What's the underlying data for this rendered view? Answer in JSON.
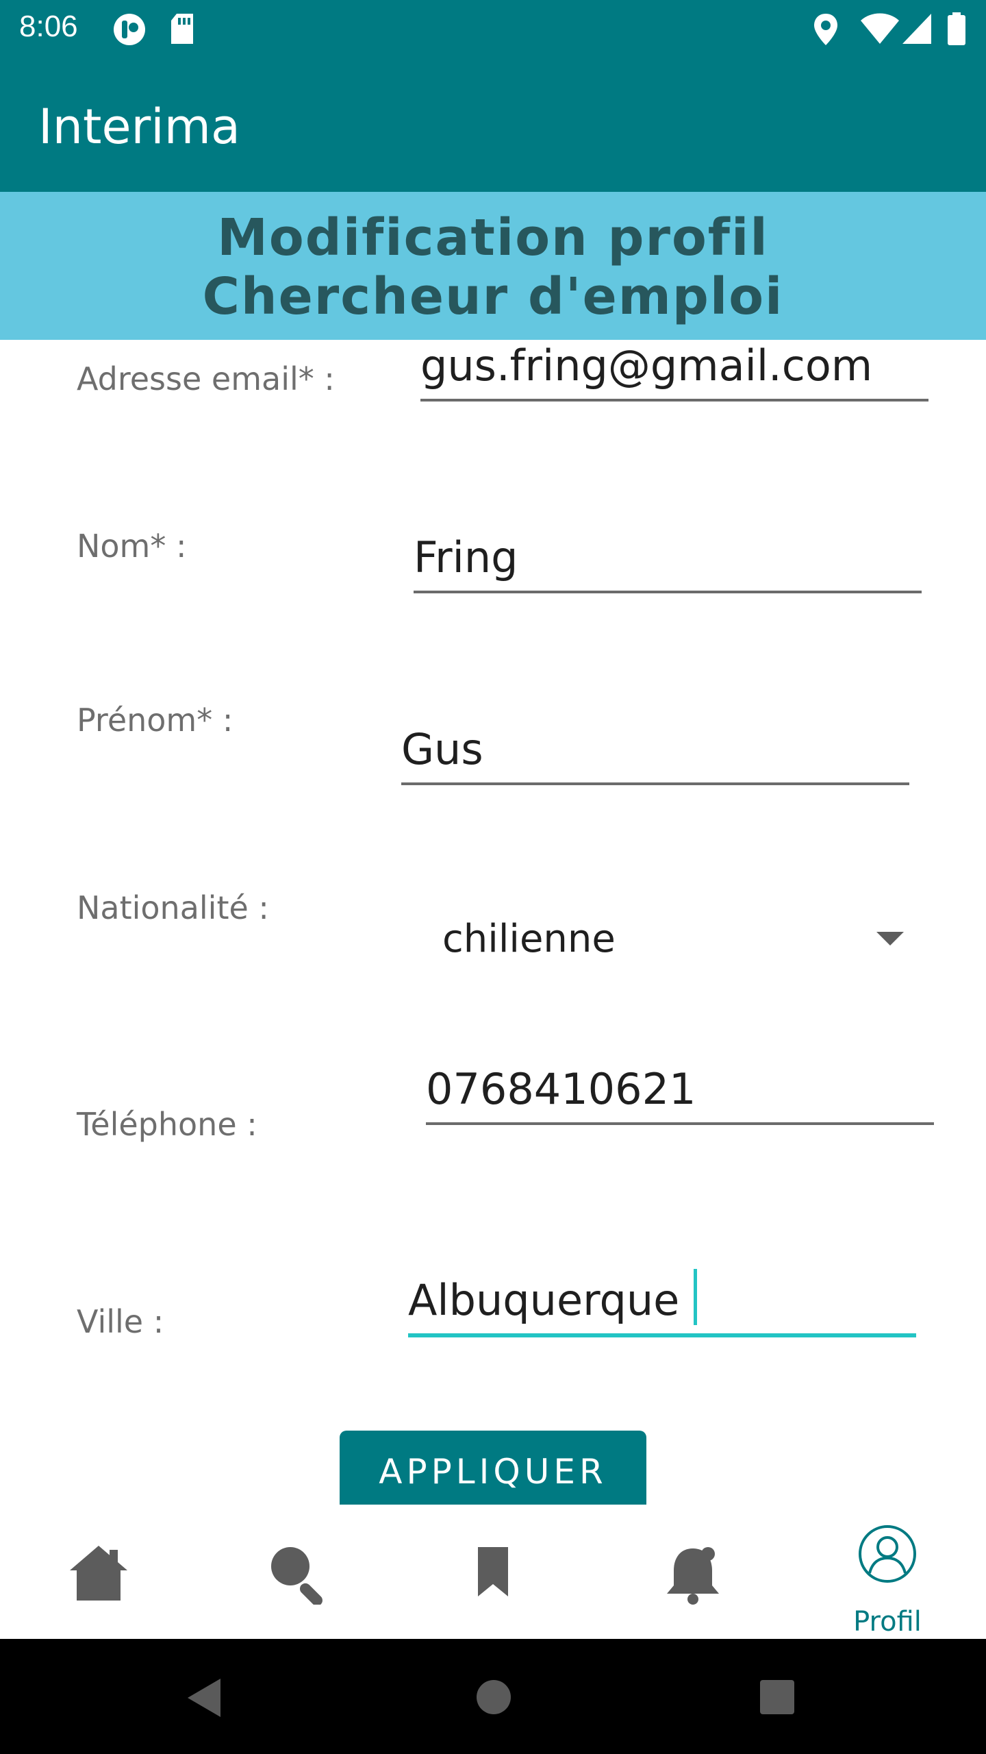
{
  "status_bar": {
    "time": "8:06",
    "icons": [
      "app-notification-icon",
      "sd-card-icon",
      "location-icon",
      "wifi-icon",
      "signal-icon",
      "battery-icon"
    ]
  },
  "app_bar": {
    "title": "Interima"
  },
  "banner": {
    "line1": "Modification profil",
    "line2": "Chercheur d'emploi"
  },
  "form": {
    "email": {
      "label": "Adresse email* :",
      "value": "gus.fring@gmail.com"
    },
    "nom": {
      "label": "Nom* :",
      "value": "Fring"
    },
    "prenom": {
      "label": "Prénom* :",
      "value": "Gus"
    },
    "nationalite": {
      "label": "Nationalité :",
      "value": "chilienne"
    },
    "telephone": {
      "label": "Téléphone :",
      "value": "0768410621"
    },
    "ville": {
      "label": "Ville :",
      "value": "Albuquerque"
    }
  },
  "apply_button": {
    "label": "APPLIQUER"
  },
  "bottom_nav": {
    "items": [
      {
        "icon": "home-icon"
      },
      {
        "icon": "search-icon"
      },
      {
        "icon": "bookmark-icon"
      },
      {
        "icon": "notification-bell-icon"
      },
      {
        "icon": "profile-icon",
        "label": "Profil",
        "active": true
      }
    ]
  },
  "colors": {
    "primary": "#007a82",
    "banner_bg": "#64c7e0",
    "banner_text": "#27575d",
    "active_underline": "#23c4c4"
  }
}
